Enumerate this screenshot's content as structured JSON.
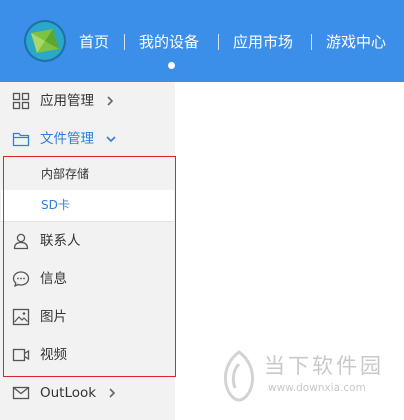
{
  "header": {
    "nav": [
      {
        "label": "首页"
      },
      {
        "label": "我的设备"
      },
      {
        "label": "应用市场"
      },
      {
        "label": "游戏中心"
      }
    ],
    "active_index": 1
  },
  "sidebar": {
    "items": [
      {
        "label": "应用管理",
        "icon": "grid-icon",
        "chevron": "right"
      },
      {
        "label": "文件管理",
        "icon": "folder-icon",
        "chevron": "down",
        "active": true
      },
      {
        "label": "联系人",
        "icon": "person-icon"
      },
      {
        "label": "信息",
        "icon": "message-icon"
      },
      {
        "label": "图片",
        "icon": "image-icon"
      },
      {
        "label": "视频",
        "icon": "video-icon"
      },
      {
        "label": "OutLook",
        "icon": "mail-icon",
        "chevron": "right"
      }
    ],
    "file_submenu": [
      {
        "label": "内部存储"
      },
      {
        "label": "SD卡",
        "selected": true
      }
    ]
  },
  "watermark": {
    "title": "当下软件园",
    "url": "www.downxia.com"
  },
  "colors": {
    "header_bg": "#3b8fe8",
    "sidebar_bg": "#f2f2f2",
    "accent": "#2f7fd8",
    "highlight_border": "#d8262c"
  }
}
